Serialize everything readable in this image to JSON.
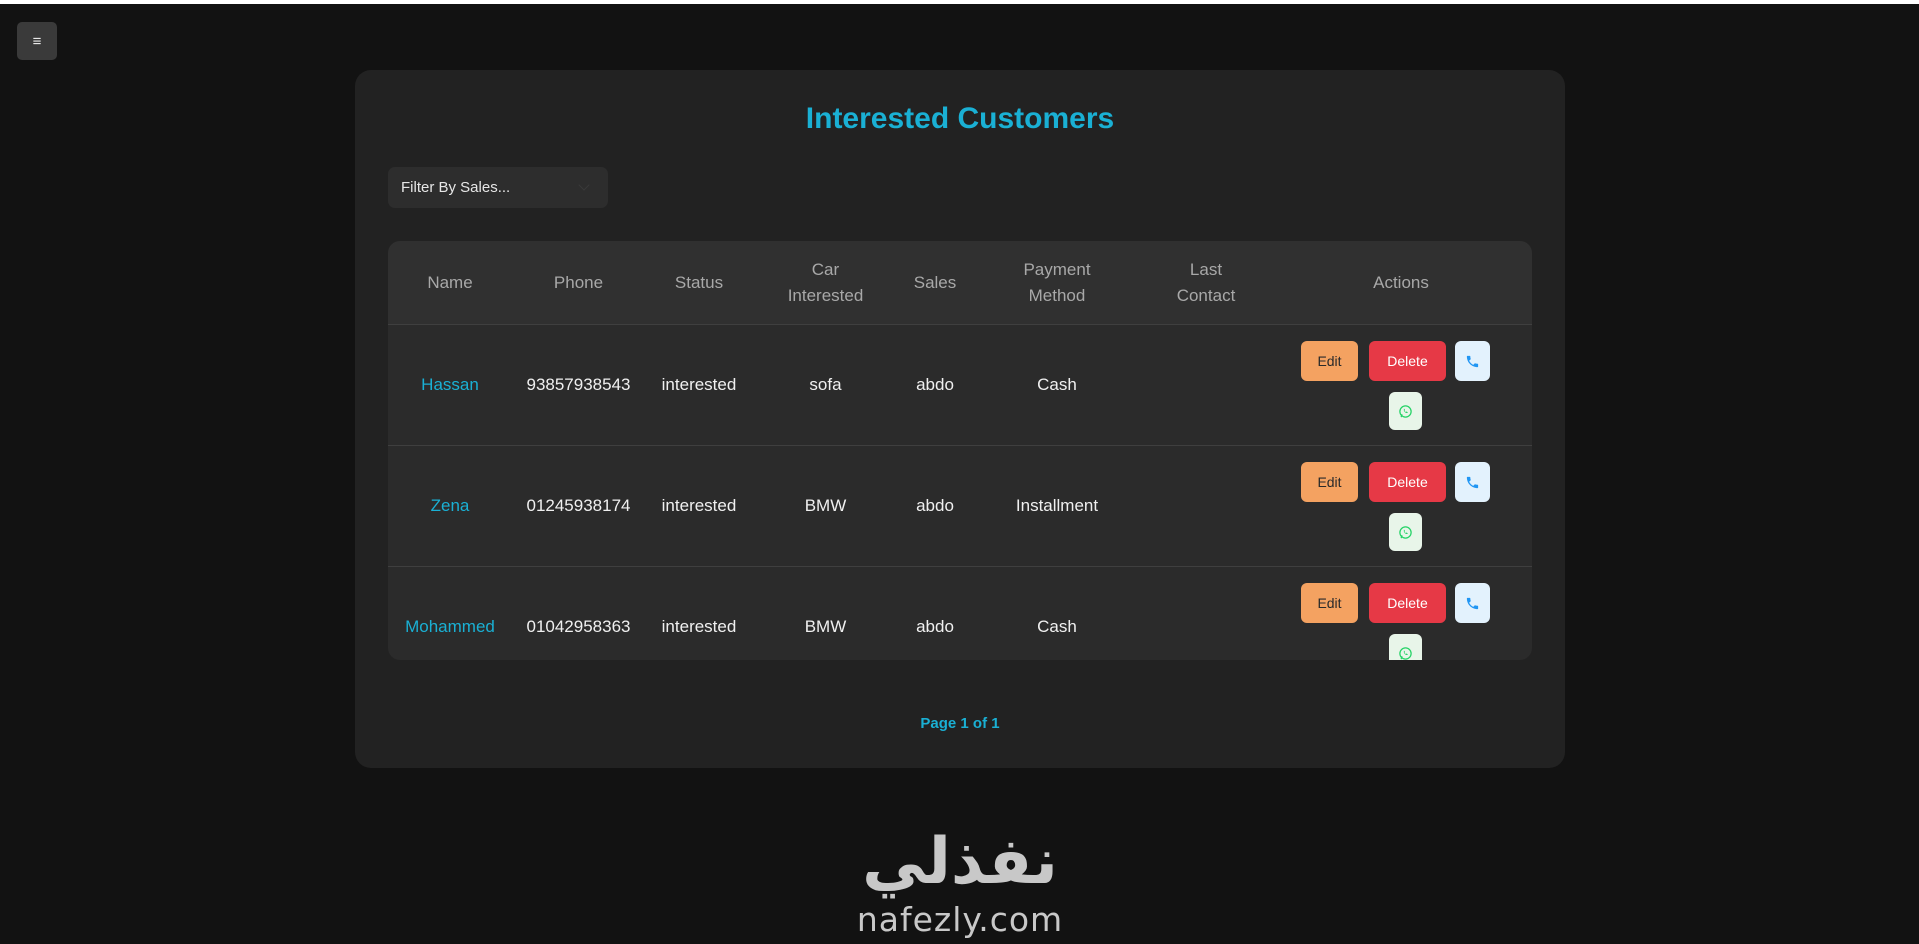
{
  "nav": {
    "menu_icon": "menu-icon",
    "menu_glyph": "≡"
  },
  "page": {
    "title": "Interested Customers"
  },
  "filter": {
    "placeholder": "Filter By Sales..."
  },
  "table": {
    "headers": {
      "name": "Name",
      "phone": "Phone",
      "status": "Status",
      "car_line1": "Car",
      "car_line2": "Interested",
      "sales": "Sales",
      "payment_line1": "Payment",
      "payment_line2": "Method",
      "last_line1": "Last",
      "last_line2": "Contact",
      "actions": "Actions"
    },
    "rows": [
      {
        "name": "Hassan",
        "phone": "93857938543",
        "status": "interested",
        "car": "sofa",
        "sales": "abdo",
        "payment": "Cash",
        "last_contact": ""
      },
      {
        "name": "Zena",
        "phone": "01245938174",
        "status": "interested",
        "car": "BMW",
        "sales": "abdo",
        "payment": "Installment",
        "last_contact": ""
      },
      {
        "name": "Mohammed",
        "phone": "01042958363",
        "status": "interested",
        "car": "BMW",
        "sales": "abdo",
        "payment": "Cash",
        "last_contact": ""
      }
    ],
    "actions": {
      "edit": "Edit",
      "delete": "Delete"
    }
  },
  "pagination": {
    "text": "Page 1 of 1"
  },
  "footer": {
    "logo_arabic": "نفذلي",
    "logo_domain": "nafezly.com"
  },
  "colors": {
    "accent": "#1ab0d4",
    "edit": "#f4a261",
    "delete": "#e63946",
    "call_bg": "#e3f2fd",
    "call_icon": "#2196f3",
    "whatsapp_bg": "#e8f5e9",
    "whatsapp_icon": "#25d366"
  }
}
